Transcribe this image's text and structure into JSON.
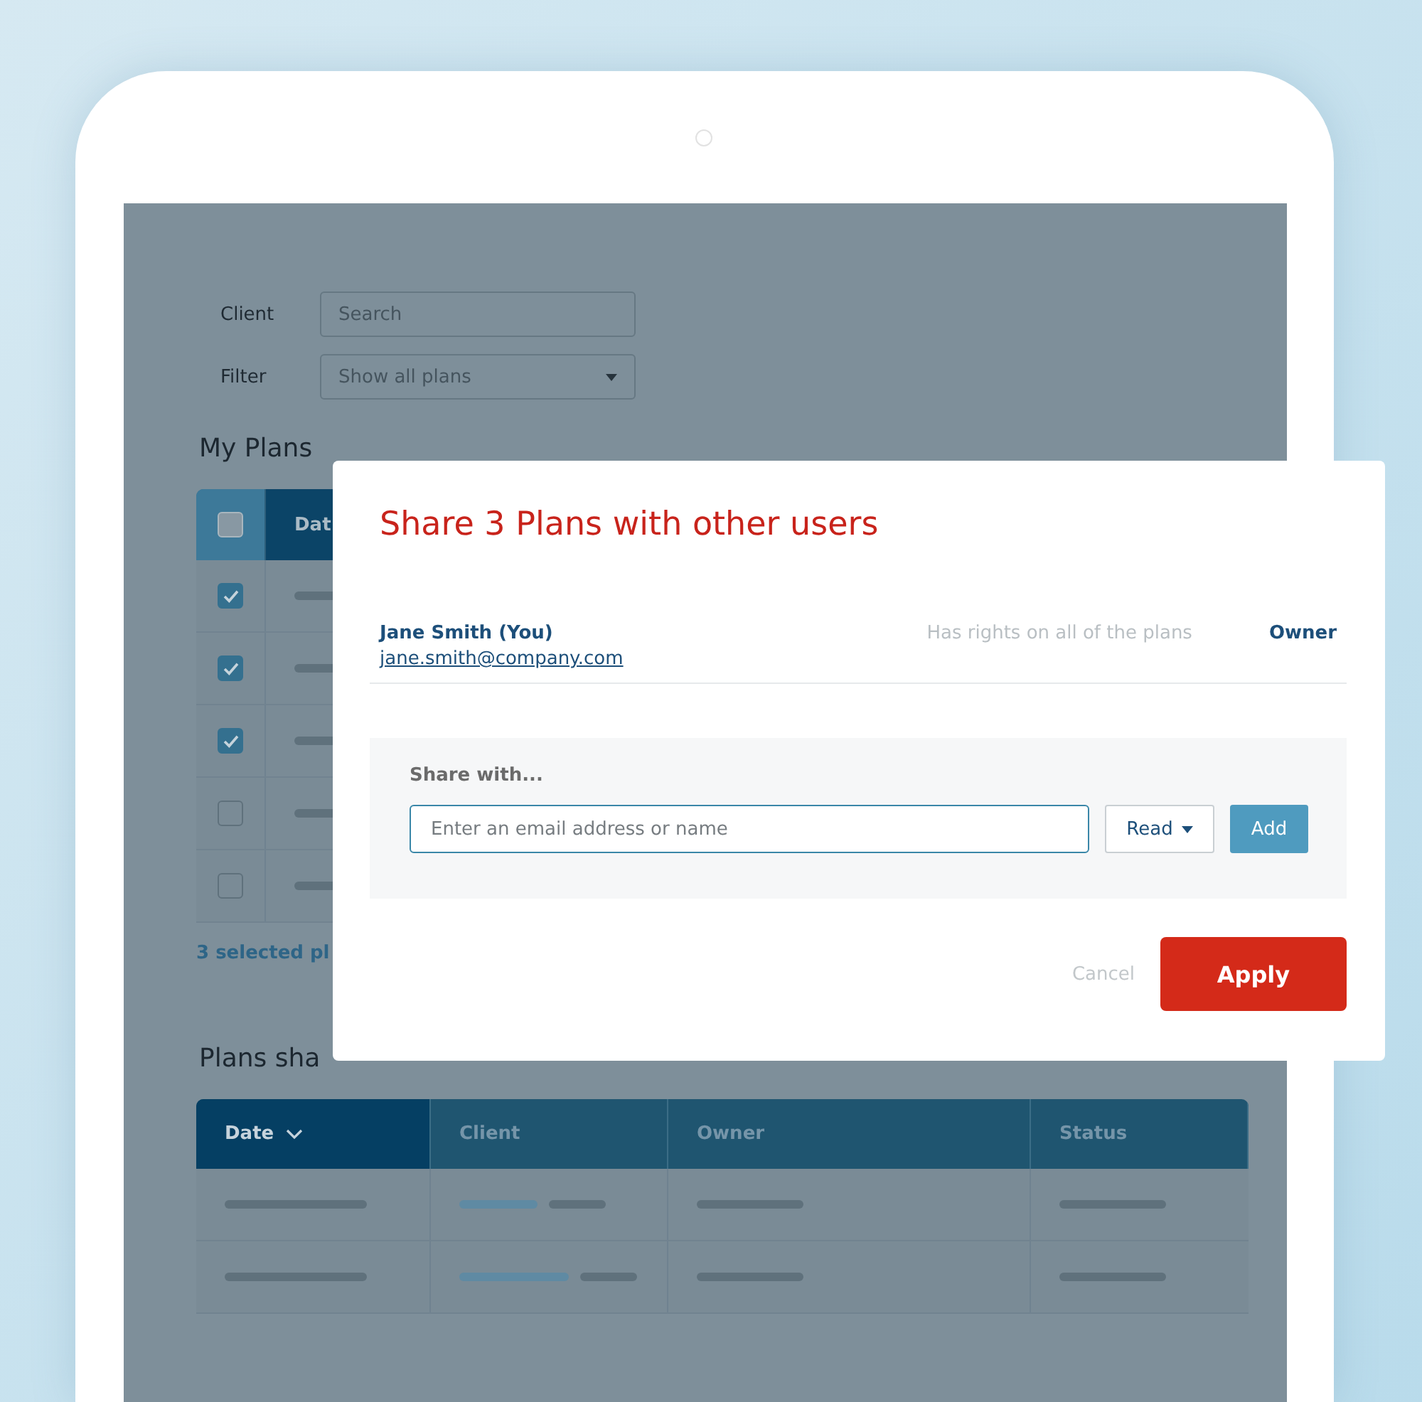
{
  "filters": [
    {
      "kind": "search",
      "label": "Client",
      "placeholder": "Search"
    },
    {
      "kind": "select",
      "label": "Filter",
      "value": "Show all plans"
    }
  ],
  "my_plans": {
    "title": "My Plans",
    "header_checked": false,
    "columns": [
      "Dat"
    ],
    "rows": [
      {
        "checked": true
      },
      {
        "checked": true
      },
      {
        "checked": true
      },
      {
        "checked": false
      },
      {
        "checked": false
      }
    ],
    "footer": "3 selected pl"
  },
  "shared_plans": {
    "title": "Plans sha",
    "columns": [
      {
        "label": "Date",
        "sorted": true
      },
      {
        "label": "Client",
        "sorted": false
      },
      {
        "label": "Owner",
        "sorted": false
      },
      {
        "label": "Status",
        "sorted": false
      }
    ],
    "rows": [
      {
        "kind": "placeholder"
      },
      {
        "kind": "placeholder"
      }
    ]
  },
  "dialog": {
    "title": "Share 3 Plans with other users",
    "user": {
      "name": "Jane Smith (You)",
      "email": "jane.smith@company.com",
      "note": "Has rights on all of the plans",
      "role": "Owner"
    },
    "share": {
      "label": "Share with...",
      "placeholder": "Enter an email address or name",
      "permission": "Read",
      "add": "Add"
    },
    "buttons": {
      "cancel": "Cancel",
      "apply": "Apply"
    }
  }
}
